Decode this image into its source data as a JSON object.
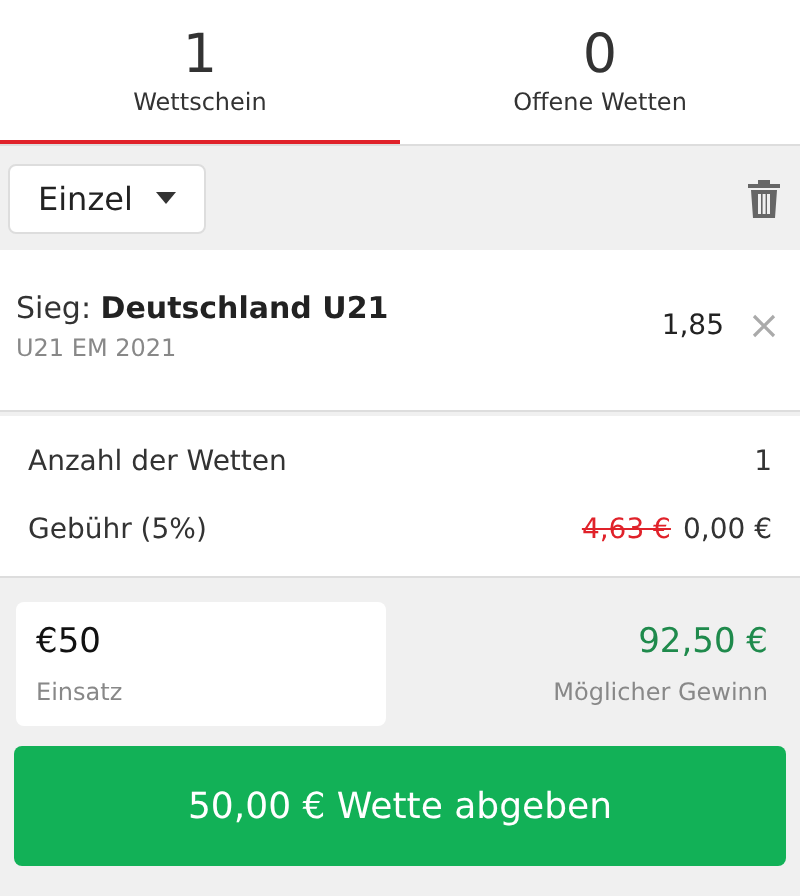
{
  "tabs": [
    {
      "count": "1",
      "label": "Wettschein",
      "selected": true
    },
    {
      "count": "0",
      "label": "Offene Wetten",
      "selected": false
    }
  ],
  "toolbar": {
    "bet_type": "Einzel"
  },
  "selections": [
    {
      "title": "Sieg: **Deutschland U21**",
      "event": "U21 EM 2021",
      "odds": "1,85"
    }
  ],
  "summary": {
    "count_label": "Anzahl der Wetten",
    "count": "1",
    "fee_label": "Gebühr (5%)",
    "fee_old": "4,63 €",
    "fee": "0,00 €"
  },
  "stake": {
    "value": "€50",
    "label": "Einsatz",
    "winnings": "92,50 €",
    "winnings_label": "Möglicher Gewinn"
  },
  "submit_button": "50,00 € Wette abgeben"
}
